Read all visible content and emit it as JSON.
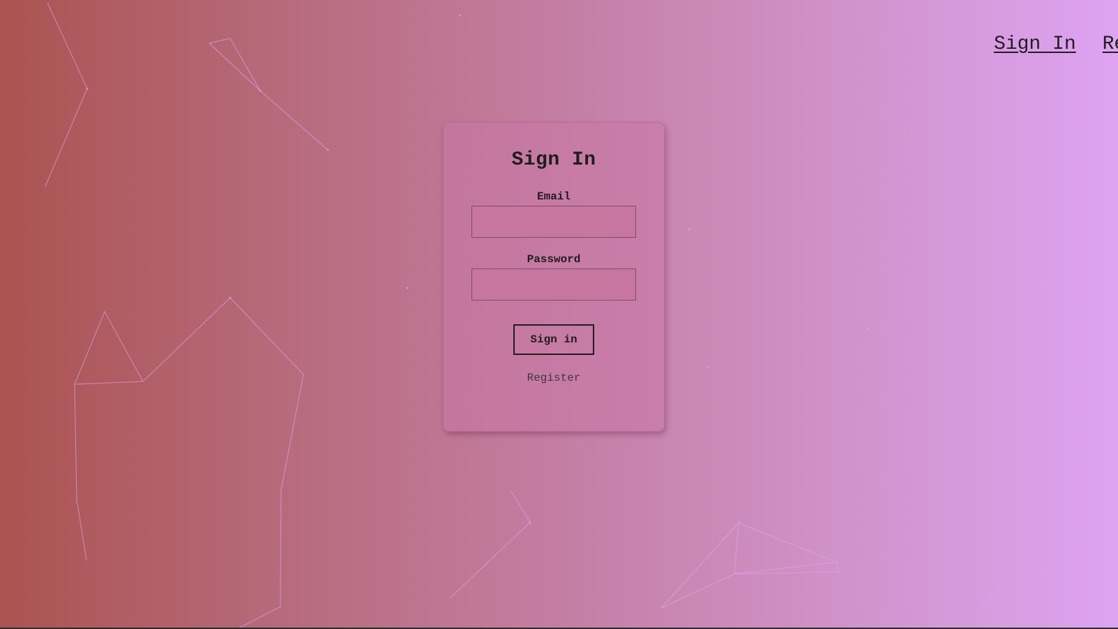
{
  "nav": {
    "links": [
      "Sign In",
      "Register"
    ]
  },
  "form": {
    "title": "Sign In",
    "email_label": "Email",
    "email_value": "",
    "password_label": "Password",
    "password_value": "",
    "submit_label": "Sign in",
    "register_label": "Register"
  },
  "colors": {
    "gradient_start": "#ab5351",
    "gradient_end": "#dea3f2",
    "line_color": "#d9a6f0"
  }
}
